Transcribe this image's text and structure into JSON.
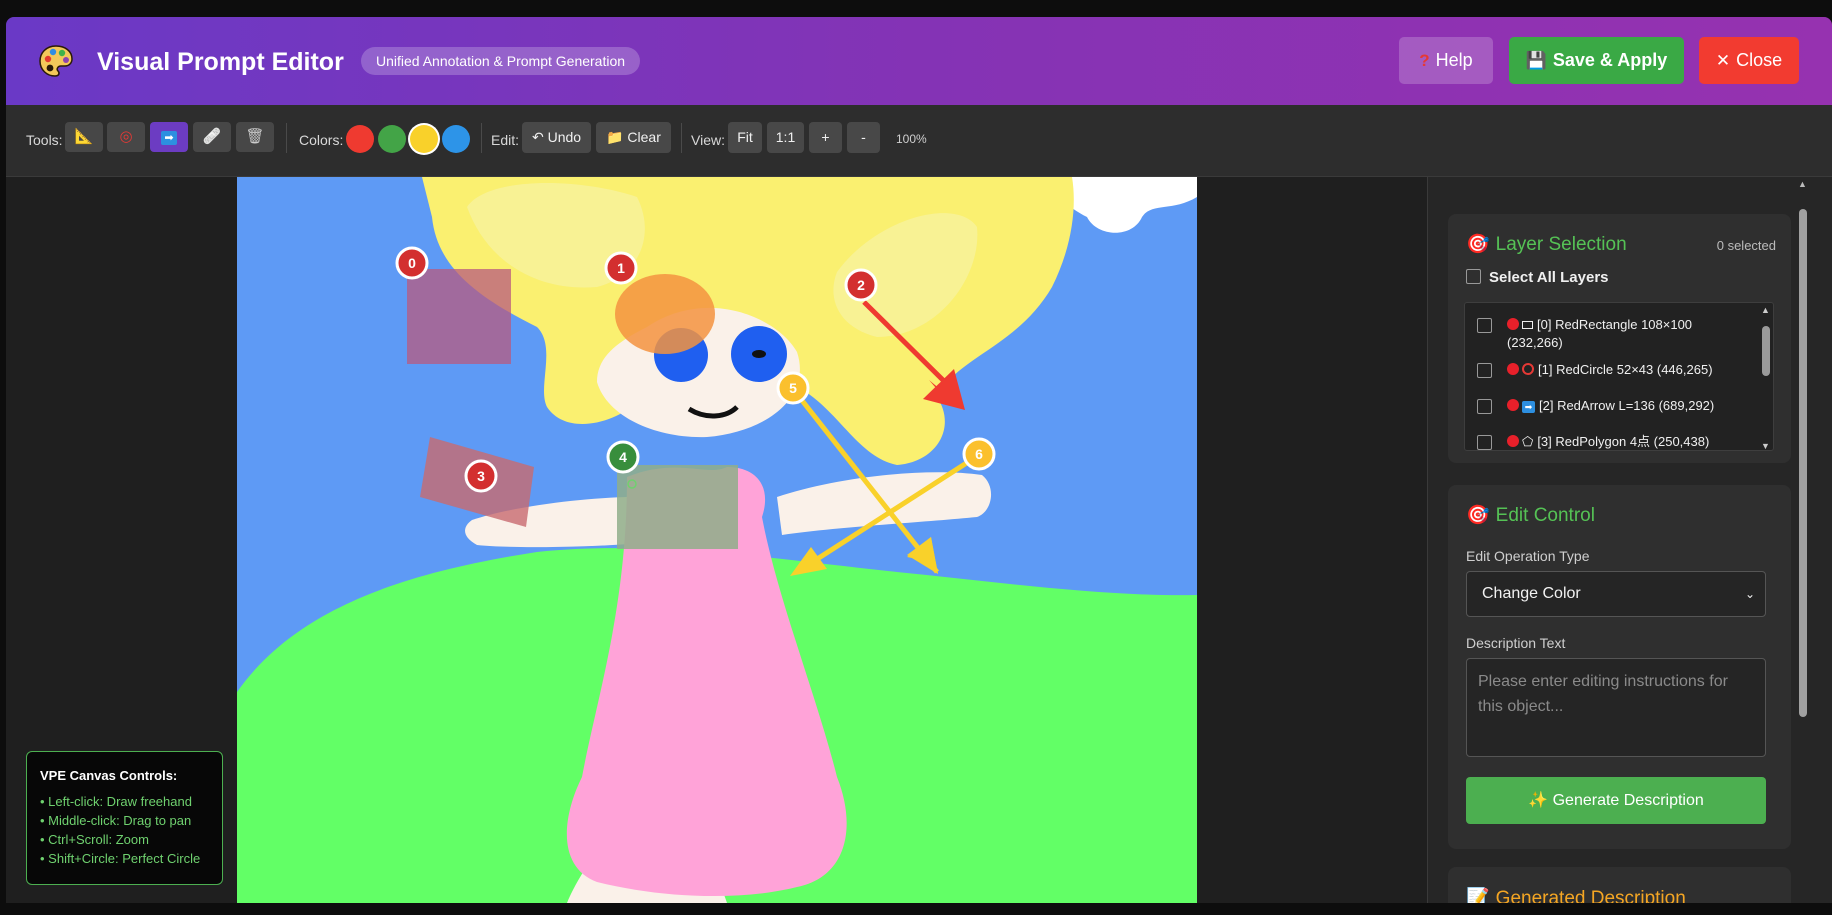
{
  "header": {
    "title": "Visual Prompt Editor",
    "subtitle": "Unified Annotation & Prompt Generation",
    "help_label": "Help",
    "save_label": "Save & Apply",
    "close_label": "Close",
    "colors": {
      "gradient_start": "#6a39c6",
      "gradient_end": "#9632b0",
      "save": "#3aa945",
      "close": "#f23b30"
    }
  },
  "toolbar": {
    "tools_label": "Tools:",
    "tools": [
      {
        "name": "rectangle-tool",
        "icon": "triangle-ruler-icon"
      },
      {
        "name": "circle-tool",
        "icon": "target-icon"
      },
      {
        "name": "arrow-tool",
        "icon": "arrow-right-icon",
        "active": true
      },
      {
        "name": "freehand-tool",
        "icon": "bandage-icon"
      },
      {
        "name": "delete-tool",
        "icon": "trash-icon"
      }
    ],
    "colors_label": "Colors:",
    "colors": [
      "#ef3a30",
      "#43a447",
      "#f9d12a",
      "#2d94e8"
    ],
    "selected_color": "#f9d12a",
    "edit_label": "Edit:",
    "undo_label": "Undo",
    "clear_label": "Clear",
    "view_label": "View:",
    "fit_label": "Fit",
    "one_to_one_label": "1:1",
    "zoom_in_label": "+",
    "zoom_out_label": "-",
    "zoom_level": "100%"
  },
  "canvas": {
    "annotations": [
      {
        "id": "0",
        "color": "#d32f2f"
      },
      {
        "id": "1",
        "color": "#d32f2f"
      },
      {
        "id": "2",
        "color": "#d32f2f"
      },
      {
        "id": "3",
        "color": "#d32f2f"
      },
      {
        "id": "4",
        "color": "#388e3c"
      },
      {
        "id": "5",
        "color": "#fbc02d"
      },
      {
        "id": "6",
        "color": "#fbc02d"
      }
    ],
    "controls": {
      "title": "VPE Canvas Controls:",
      "lines": [
        "• Left-click: Draw freehand",
        "• Middle-click: Drag to pan",
        "• Ctrl+Scroll: Zoom",
        "• Shift+Circle: Perfect Circle"
      ]
    }
  },
  "layer_selection": {
    "title": "Layer Selection",
    "selected_count": "0 selected",
    "select_all_label": "Select All Layers",
    "layers": [
      {
        "text": "[0] RedRectangle 108×100 (232,266)",
        "icon": "rectangle-icon"
      },
      {
        "text": "[1] RedCircle 52×43 (446,265)",
        "icon": "circle-icon"
      },
      {
        "text": "[2] RedArrow L=136 (689,292)",
        "icon": "arrow-icon"
      },
      {
        "text": "[3] RedPolygon 4点 (250,438)",
        "icon": "polygon-icon"
      }
    ]
  },
  "edit_control": {
    "title": "Edit Control",
    "operation_label": "Edit Operation Type",
    "operation_value": "Change Color",
    "description_label": "Description Text",
    "description_placeholder": "Please enter editing instructions for this object...",
    "generate_label": "Generate Description"
  },
  "generated": {
    "title": "Generated Description"
  }
}
